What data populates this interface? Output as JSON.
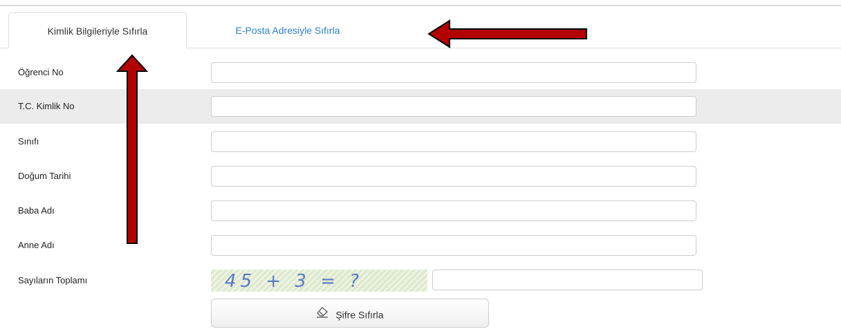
{
  "tabs": [
    {
      "label": "Kimlik Bilgileriyle Sıfırla",
      "active": true
    },
    {
      "label": "E-Posta Adresiyle Sıfırla",
      "active": false
    }
  ],
  "form": {
    "fields": [
      {
        "label": "Öğrenci No",
        "value": "",
        "placeholder": ""
      },
      {
        "label": "T.C. Kimlik No",
        "value": "",
        "placeholder": ""
      },
      {
        "label": "Sınıfı",
        "value": "",
        "placeholder": ""
      },
      {
        "label": "Doğum Tarihi",
        "value": "",
        "placeholder": ""
      },
      {
        "label": "Baba Adı",
        "value": "",
        "placeholder": ""
      },
      {
        "label": "Anne Adı",
        "value": "",
        "placeholder": ""
      }
    ],
    "captcha": {
      "label": "Sayıların Toplamı",
      "image_text": "45 + 3 = ?",
      "value": ""
    },
    "submit": {
      "label": "Şifre Sıfırla",
      "icon": "eraser-icon"
    }
  },
  "annotations": {
    "arrow_color": "#b30000",
    "arrow_outline": "#000000"
  },
  "colors": {
    "link": "#2a7fd4",
    "row_shade": "#ececec",
    "border": "#cccccc"
  }
}
